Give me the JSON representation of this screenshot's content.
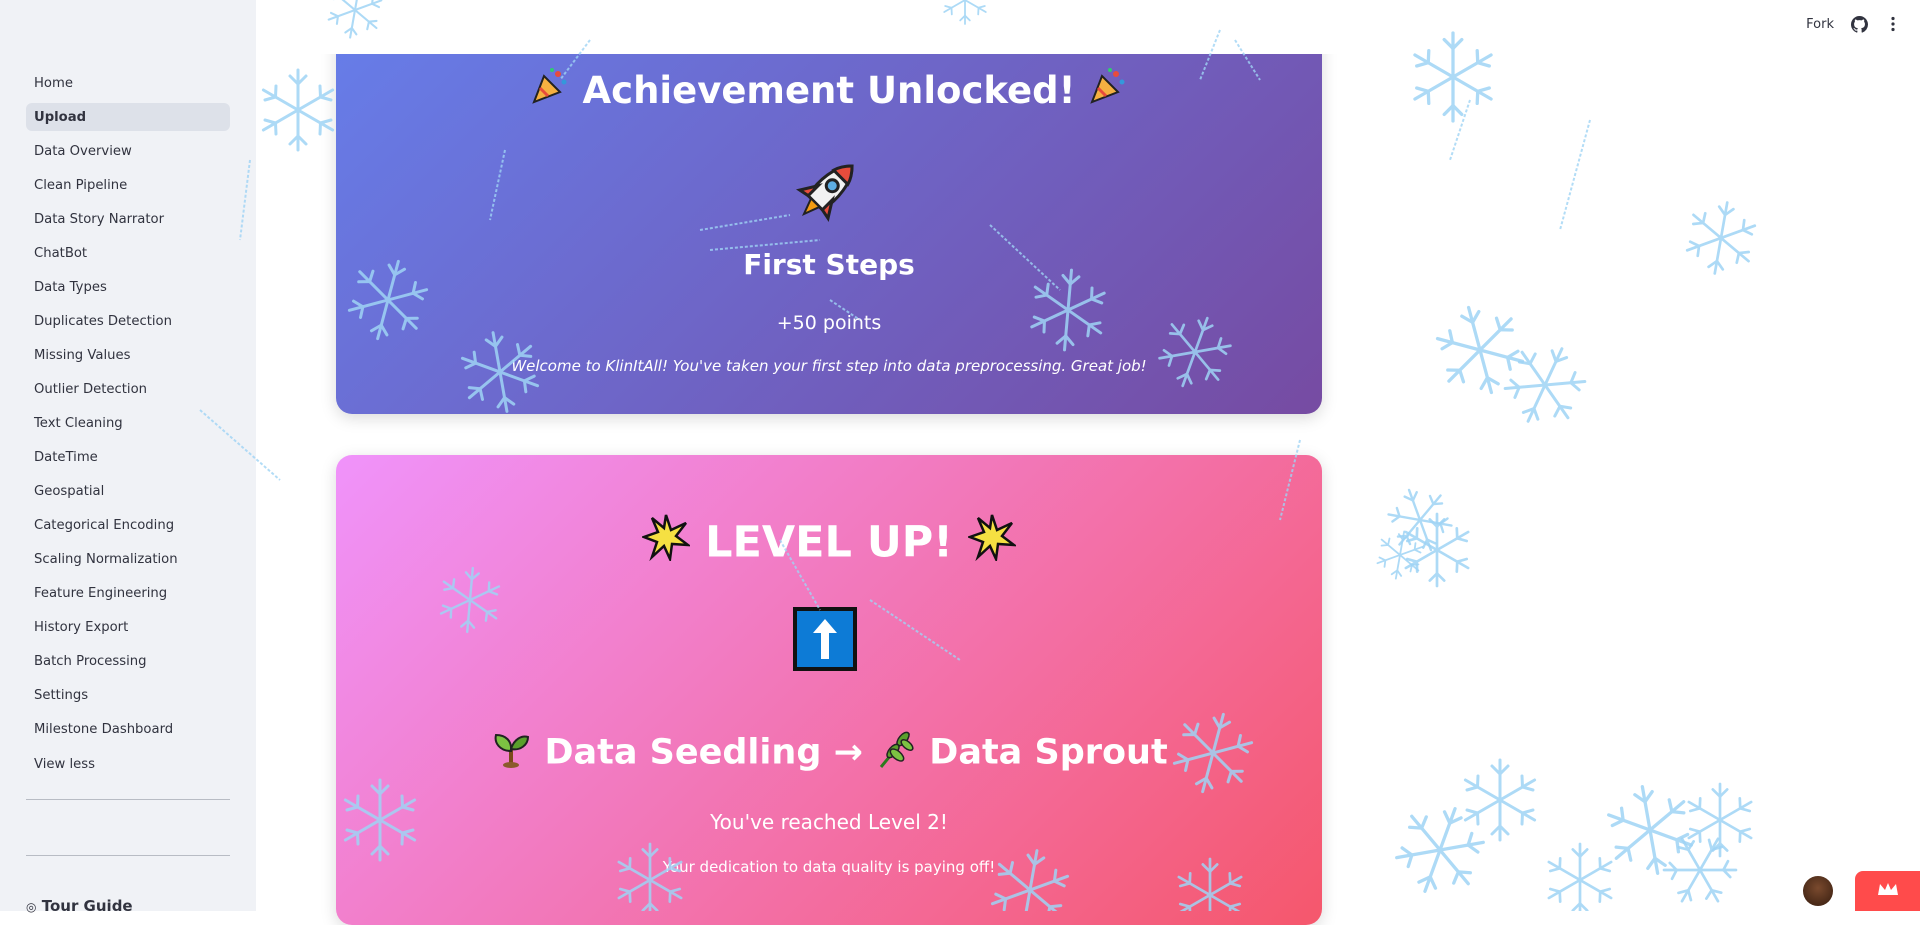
{
  "sidebar": {
    "items": [
      {
        "label": "Home",
        "active": false
      },
      {
        "label": "Upload",
        "active": true
      },
      {
        "label": "Data Overview",
        "active": false
      },
      {
        "label": "Clean Pipeline",
        "active": false
      },
      {
        "label": "Data Story Narrator",
        "active": false
      },
      {
        "label": "ChatBot",
        "active": false
      },
      {
        "label": "Data Types",
        "active": false
      },
      {
        "label": "Duplicates Detection",
        "active": false
      },
      {
        "label": "Missing Values",
        "active": false
      },
      {
        "label": "Outlier Detection",
        "active": false
      },
      {
        "label": "Text Cleaning",
        "active": false
      },
      {
        "label": "DateTime",
        "active": false
      },
      {
        "label": "Geospatial",
        "active": false
      },
      {
        "label": "Categorical Encoding",
        "active": false
      },
      {
        "label": "Scaling Normalization",
        "active": false
      },
      {
        "label": "Feature Engineering",
        "active": false
      },
      {
        "label": "History Export",
        "active": false
      },
      {
        "label": "Batch Processing",
        "active": false
      },
      {
        "label": "Settings",
        "active": false
      },
      {
        "label": "Milestone Dashboard",
        "active": false
      }
    ],
    "view_less": "View less",
    "tour_guide": "Tour Guide"
  },
  "header": {
    "fork_label": "Fork",
    "github_icon": "github-icon",
    "menu_icon": "kebab-menu-icon"
  },
  "achievement": {
    "title": "Achievement Unlocked!",
    "left_icon": "party-popper-icon",
    "right_icon": "party-popper-icon",
    "badge_icon": "rocket-icon",
    "name": "First Steps",
    "points": "+50 points",
    "description": "Welcome to KlinItAll! You've taken your first step into data preprocessing. Great job!"
  },
  "level_up": {
    "title": "LEVEL UP!",
    "left_icon": "star-burst-icon",
    "right_icon": "star-burst-icon",
    "badge_icon": "up-arrow-icon",
    "from_level": "Data Seedling",
    "arrow": "→",
    "to_level": "Data Sprout",
    "reached": "You've reached Level 2!",
    "description": "Your dedication to data quality is paying off!"
  },
  "colors": {
    "sidebar_bg": "#f0f2f6",
    "achievement_gradient": [
      "#667eea",
      "#764ba2"
    ],
    "levelup_gradient": [
      "#f093fb",
      "#f5576c"
    ],
    "snow": "#9fd4f5",
    "badge_red": "#ff4b4b"
  }
}
